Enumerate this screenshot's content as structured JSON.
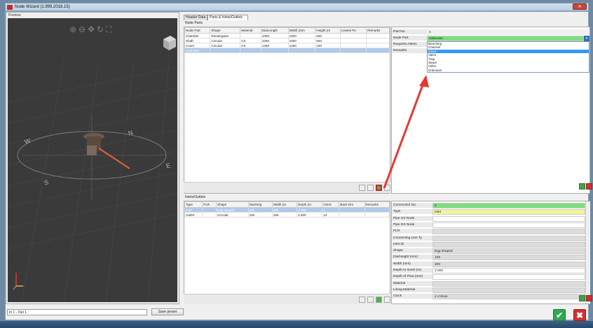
{
  "window": {
    "title": "Node Wizard (1.999.2018.15)",
    "close_glyph": "✕"
  },
  "preview": {
    "label": "Preview",
    "tools": [
      "zoom-in-icon",
      "zoom-out-icon",
      "pan-icon",
      "rotate-icon",
      "fit-icon"
    ],
    "compass": {
      "n": "N",
      "e": "E",
      "s": "S",
      "w": "W"
    }
  },
  "status": {
    "value": "In 1 - Out 1",
    "save_preset": "Save preset"
  },
  "tabs": [
    {
      "label": "Header Data"
    },
    {
      "label": "Parts & Inlets/Outlets"
    }
  ],
  "node_parts": {
    "label": "Node Parts",
    "columns": [
      "Node Part",
      "Shape",
      "Material",
      "Dia/Length",
      "Width (mm",
      "Height (m",
      "Lowest Po",
      "Remarks"
    ],
    "rows": [
      [
        "Chamber",
        "Rectangular",
        "",
        "1000",
        "1000",
        "500",
        "",
        ""
      ],
      [
        "Shaft",
        "Circular",
        "CS",
        "1000",
        "1000",
        "500",
        "",
        ""
      ],
      [
        "Cover",
        "Circular",
        "CS",
        "1250",
        "1250",
        "100",
        "",
        ""
      ],
      [
        "Unknown",
        "",
        "",
        "",
        "",
        "",
        "",
        ""
      ]
    ],
    "selected_row": 3
  },
  "part_props": {
    "part_no_label": "Part No.",
    "part_no": "4",
    "node_part_label": "Node Part",
    "node_part": "Unknown",
    "requires_label": "Requires Attent.",
    "remarks_label": "Remarks",
    "options": [
      "Benching",
      "Channel",
      "Insert",
      "Valve",
      "Trap",
      "Steps",
      "Other",
      "Unknown"
    ],
    "selected_option": 2
  },
  "inlets": {
    "label": "Inlets/Outlets",
    "columns": [
      "Type",
      "PLR",
      "Shape",
      "Dia/Heig",
      "Width (m",
      "Depth (m",
      "Clock",
      "Back Dro",
      "Remarks"
    ],
    "rows": [
      [
        "Inlet",
        "",
        "Egg shaped",
        "125",
        "200",
        "2.000",
        "4",
        "",
        ""
      ],
      [
        "Outlet",
        "",
        "Circular",
        "150",
        "150",
        "2.300",
        "12",
        "",
        ""
      ]
    ],
    "selected_row": 0
  },
  "conn_props": [
    {
      "label": "Connection No.",
      "value": "2",
      "style": "green"
    },
    {
      "label": "Type",
      "value": "Inlet",
      "style": "yellow"
    },
    {
      "label": "Pipe US Node",
      "value": "",
      "style": "white"
    },
    {
      "label": "Pipe DS Node",
      "value": "",
      "style": "white"
    },
    {
      "label": "PLR",
      "value": "",
      "style": "grey"
    },
    {
      "label": "Connecting Line Ty",
      "value": "",
      "style": "grey"
    },
    {
      "label": "Inlet ID",
      "value": "",
      "style": "grey"
    },
    {
      "label": "Shape",
      "value": "Egg shaped",
      "style": "grey"
    },
    {
      "label": "Dia/Height (mm)",
      "value": "125",
      "style": "grey"
    },
    {
      "label": "Width (mm)",
      "value": "200",
      "style": "grey"
    },
    {
      "label": "Depth to Invert (m)",
      "value": "2.000",
      "style": "white"
    },
    {
      "label": "Depth of Flow (mm)",
      "value": "",
      "style": "white"
    },
    {
      "label": "Material",
      "value": "",
      "style": "grey"
    },
    {
      "label": "Lining Material",
      "value": "",
      "style": "grey"
    },
    {
      "label": "Clock",
      "value": "4 o'clock",
      "style": "grey"
    }
  ],
  "colors": {
    "accent_green": "#2fa84f",
    "accent_red": "#d32f2f",
    "arrow_red": "#e53935",
    "selection": "#3399ff"
  }
}
